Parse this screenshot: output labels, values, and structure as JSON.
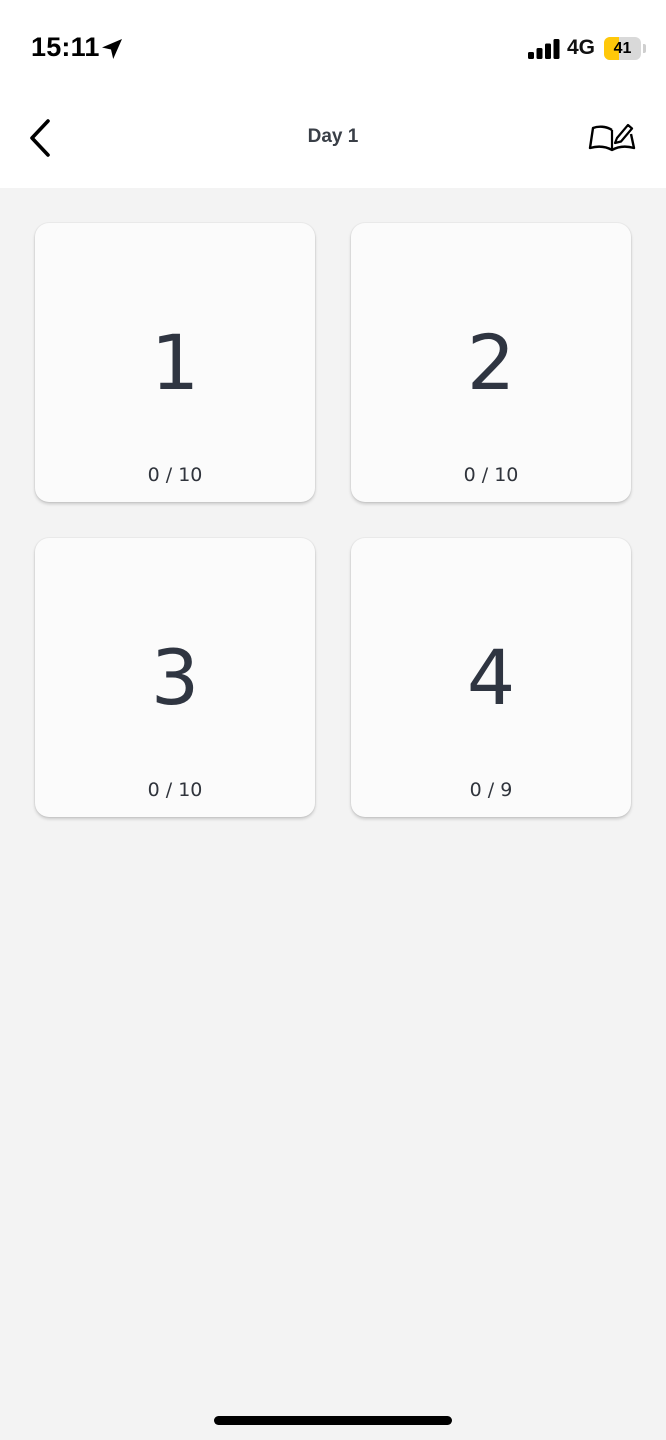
{
  "status_bar": {
    "time": "15:11",
    "network": "4G",
    "battery_level": "41",
    "battery_fraction": 0.41,
    "battery_color": "#ffc80a",
    "location_icon": "location-arrow-icon",
    "signal_icon": "cellular-signal-icon"
  },
  "nav": {
    "back_icon": "chevron-left-icon",
    "title": "Day 1",
    "right_icon": "open-book-pencil-icon"
  },
  "cards": [
    {
      "number": "1",
      "progress": "0 / 10"
    },
    {
      "number": "2",
      "progress": "0 / 10"
    },
    {
      "number": "3",
      "progress": "0 / 10"
    },
    {
      "number": "4",
      "progress": "0 / 9"
    }
  ]
}
